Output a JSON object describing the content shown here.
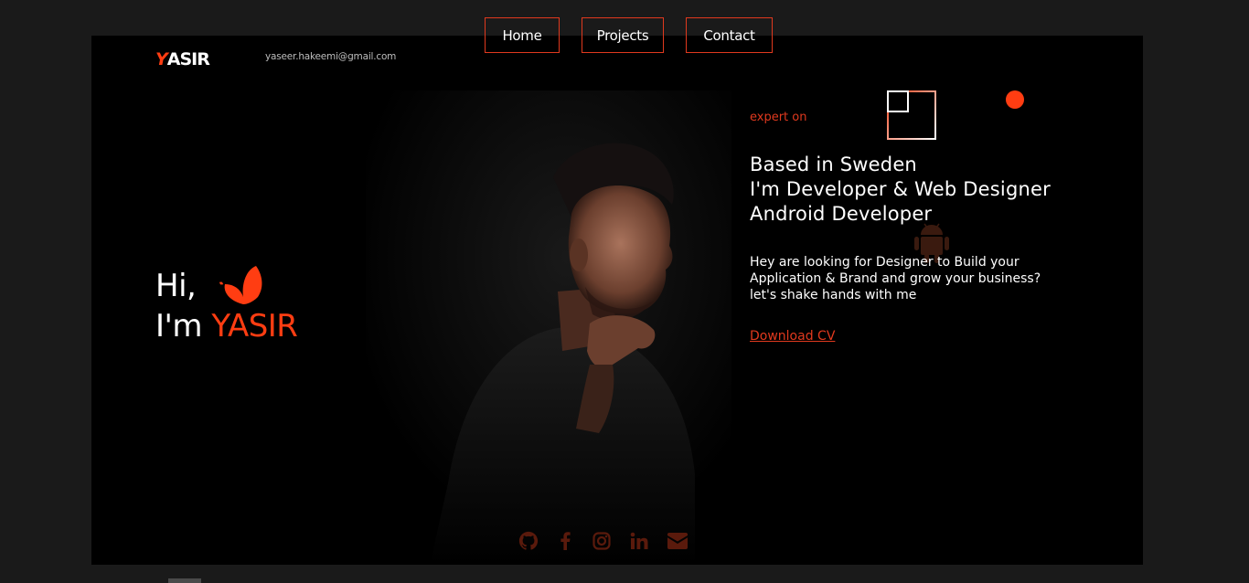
{
  "nav": {
    "items": [
      {
        "label": "Home"
      },
      {
        "label": "Projects"
      },
      {
        "label": "Contact"
      }
    ]
  },
  "header": {
    "logo_initial": "Y",
    "logo_rest": "ASIR",
    "email": "yaseer.hakeemi@gmail.com"
  },
  "hero": {
    "greeting": "Hi,",
    "intro": "I'm",
    "name": "YASIR"
  },
  "about": {
    "expert_label": "expert on",
    "roles": [
      "Based in Sweden",
      "I'm Developer & Web Designer",
      "Android Developer"
    ],
    "blurb_lines": [
      "Hey are looking for Designer to Build your",
      "Application & Brand and grow your business?",
      "let's shake hands with me"
    ],
    "download_label": "Download CV"
  },
  "socials": [
    "github-icon",
    "facebook-icon",
    "instagram-icon",
    "linkedin-icon",
    "email-icon"
  ],
  "colors": {
    "accent": "#ff3d12",
    "accent_dark": "#e0391e",
    "social": "#5a1a0c",
    "frame_bg": "#000000",
    "page_bg": "#1a1a1a"
  }
}
